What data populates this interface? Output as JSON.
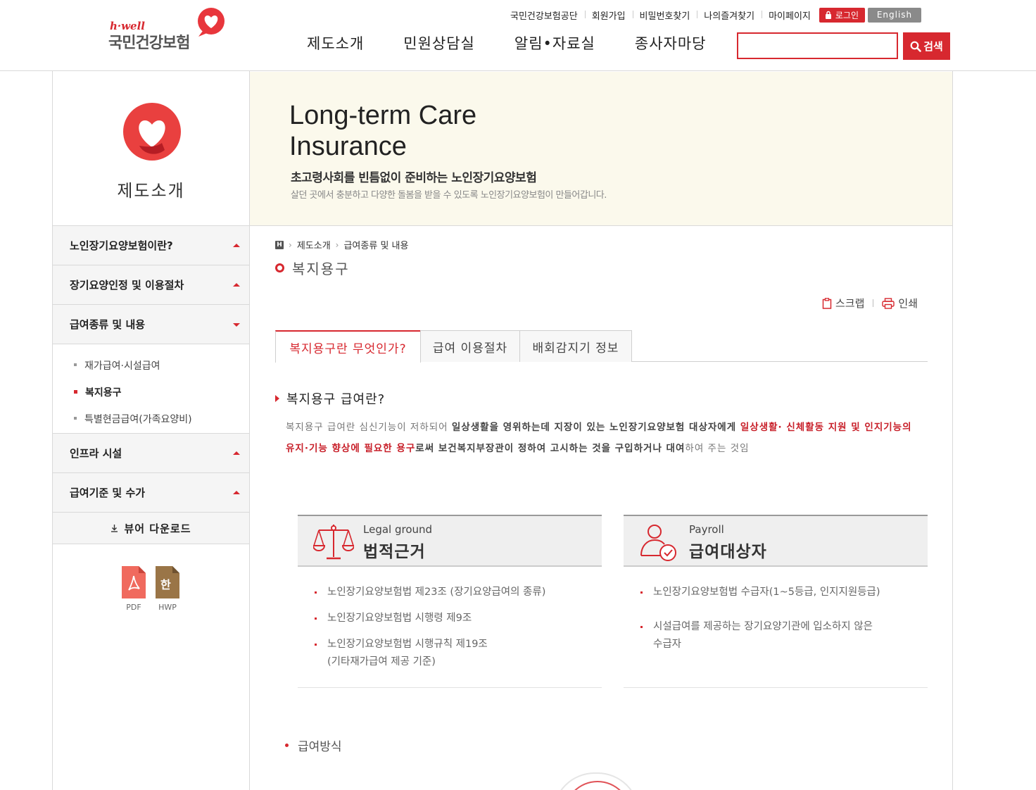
{
  "header": {
    "logo_small": "h·well",
    "logo_text": "국민건강보험",
    "util_links": [
      "국민건강보험공단",
      "회원가입",
      "비밀번호찾기",
      "나의즐겨찾기",
      "마이페이지"
    ],
    "login_label": "로그인",
    "english_label": "English",
    "gnb": [
      "제도소개",
      "민원상담실",
      "알림•자료실",
      "종사자마당"
    ],
    "search_placeholder": "",
    "search_label": "검색"
  },
  "sidebar": {
    "title": "제도소개",
    "menu": [
      {
        "label": "노인장기요양보험이란?",
        "state": "collapsed"
      },
      {
        "label": "장기요양인정 및 이용절차",
        "state": "collapsed"
      },
      {
        "label": "급여종류 및 내용",
        "state": "expanded"
      },
      {
        "label": "인프라 시설",
        "state": "collapsed"
      },
      {
        "label": "급여기준 및 수가",
        "state": "collapsed"
      }
    ],
    "submenu": [
      {
        "label": "재가급여·시설급여",
        "active": false
      },
      {
        "label": "복지용구",
        "active": true
      },
      {
        "label": "특별현금급여(가족요양비)",
        "active": false
      }
    ],
    "viewer_download": "뷰어 다운로드",
    "files": [
      {
        "icon": "pdf-icon",
        "label": "PDF"
      },
      {
        "icon": "hwp-icon",
        "label": "HWP",
        "glyph": "한"
      }
    ]
  },
  "banner": {
    "title_line1": "Long-term Care",
    "title_line2": "Insurance",
    "subtitle": "초고령사회를 빈틈없이 준비하는 노인장기요양보험",
    "description": "살던 곳에서 충분하고 다양한 돌봄을 받을 수 있도록 노인장기요양보험이 만들어갑니다."
  },
  "breadcrumb": {
    "home_glyph": "H",
    "items": [
      "제도소개",
      "급여종류 및 내용"
    ]
  },
  "page_title": "복지용구",
  "tools": {
    "scrap": "스크랩",
    "print": "인쇄"
  },
  "tabs": [
    {
      "label": "복지용구란 무엇인가?",
      "active": true
    },
    {
      "label": "급여 이용절차",
      "active": false
    },
    {
      "label": "배회감지기 정보",
      "active": false
    }
  ],
  "section": {
    "heading": "복지용구 급여란?",
    "body_plain1": "복지용구 급여란 심신기능이 저하되어 ",
    "body_bold1": "일상생활을 영위하는데 지장이 있는 노인장기요양보험 대상자에게 ",
    "body_highlight": "일상생활· 신체활동 지원 및 인지기능의 유지·기능 향상에 필요한 용구",
    "body_bold2": "로써 보건복지부장관이 정하여 고시하는 것을 구입하거나 대여",
    "body_plain2": "하여 주는 것임"
  },
  "cards": [
    {
      "icon": "scale-icon",
      "title_en": "Legal ground",
      "title_ko": "법적근거",
      "items": [
        "노인장기요양보험법 제23조 (장기요양급여의 종류)",
        "노인장기요양보험법 시행령 제9조",
        "노인장기요양보험법 시행규칙 제19조\n(기타재가급여 제공 기준)"
      ]
    },
    {
      "icon": "user-check-icon",
      "title_en": "Payroll",
      "title_ko": "급여대상자",
      "items": [
        "노인장기요양보험법 수급자(1~5등급, 인지지원등급)",
        "시설급여를 제공하는 장기요양기관에 입소하지 않은\n수급자"
      ]
    }
  ],
  "method_heading": "급여방식",
  "colors": {
    "accent": "#d7282f",
    "banner_bg": "#fbf9ec",
    "sidebar_bg": "#f5f5f5"
  }
}
